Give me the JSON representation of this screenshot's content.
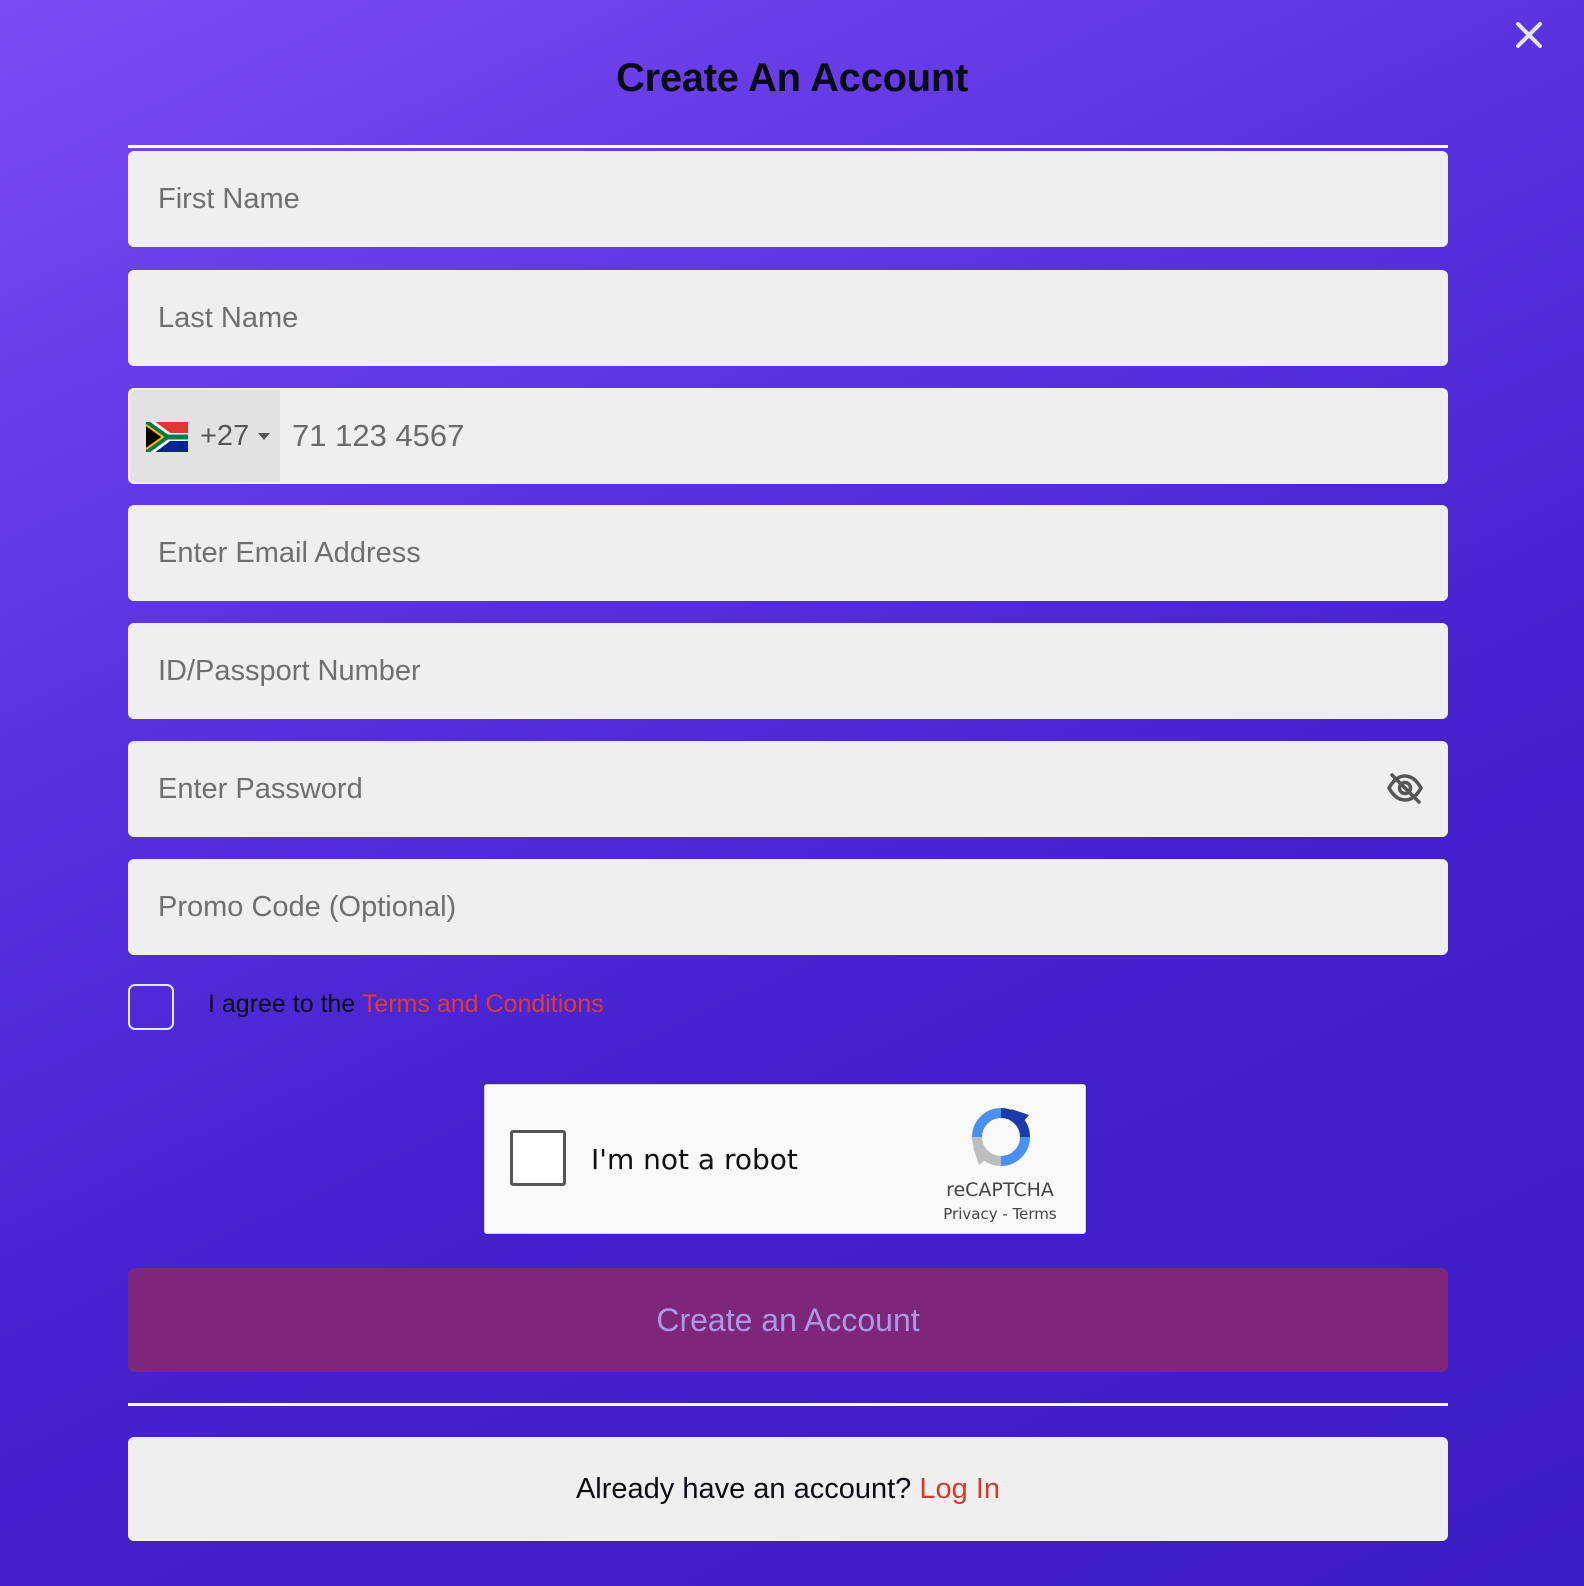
{
  "modal": {
    "title": "Create An Account",
    "close_icon": "close-icon"
  },
  "form": {
    "first_name": {
      "placeholder": "First Name",
      "value": ""
    },
    "last_name": {
      "placeholder": "Last Name",
      "value": ""
    },
    "phone": {
      "country_flag": "south-africa-flag-icon",
      "dial_code": "+27",
      "placeholder": "71 123 4567",
      "value": ""
    },
    "email": {
      "placeholder": "Enter Email Address",
      "value": ""
    },
    "id_passport": {
      "placeholder": "ID/Passport Number",
      "value": ""
    },
    "password": {
      "placeholder": "Enter Password",
      "value": "",
      "toggle_icon": "eye-slash-icon"
    },
    "promo_code": {
      "placeholder": "Promo Code (Optional)",
      "value": ""
    }
  },
  "terms": {
    "checked": false,
    "prefix": "I agree to the ",
    "link_label": "Terms and Conditions"
  },
  "captcha": {
    "label": "I'm not a robot",
    "brand": "reCAPTCHA",
    "privacy_label": "Privacy",
    "separator": " - ",
    "terms_label": "Terms"
  },
  "submit": {
    "label": "Create an Account"
  },
  "login": {
    "prompt": "Already have an account? ",
    "link_label": "Log In"
  },
  "colors": {
    "background_start": "#7a4cf4",
    "background_end": "#3a1cc4",
    "submit_bg": "#7e267a",
    "submit_text": "#a99ae6",
    "link": "#e03a2a",
    "field_bg": "#efefef"
  }
}
